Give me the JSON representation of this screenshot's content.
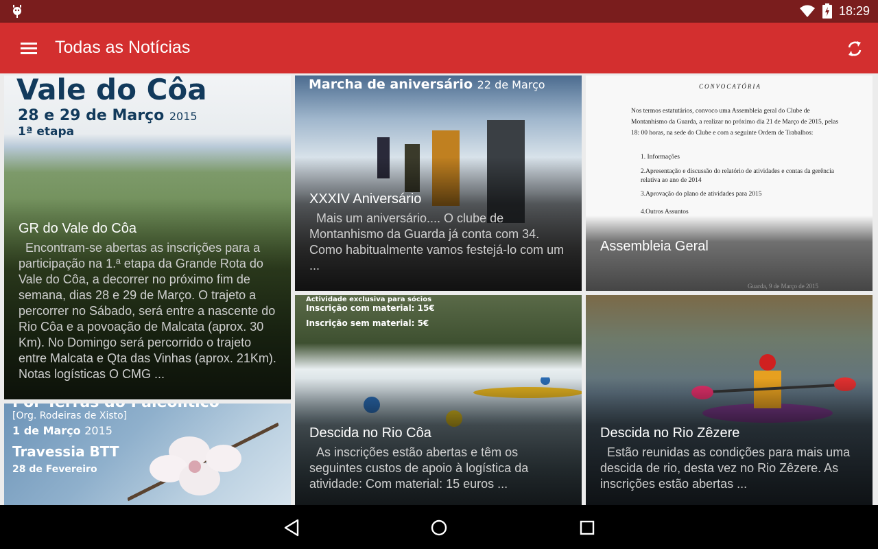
{
  "status": {
    "time": "18:29"
  },
  "appbar": {
    "title": "Todas as Notícias"
  },
  "cards": [
    {
      "title": "GR do Vale do Côa",
      "description": "Encontram-se abertas as inscrições para a participação na 1.ª etapa da Grande Rota do Vale do Côa, a decorrer no próximo fim de semana, dias 28 e 29 de Março. O trajeto a percorrer no Sábado, será entre a nascente do Rio Côa e a povoação de Malcata (aprox. 30 Km). No Domingo será percorrido o trajeto entre Malcata e Qta das Vinhas (aprox. 21Km). Notas logísticas O CMG ...",
      "poster": {
        "line1": "Vale do Côa",
        "line2": "28 e 29 de Março",
        "year": "2015",
        "line3": "1ª etapa"
      }
    },
    {
      "title": "XXXIV Aniversário",
      "description": "Mais um aniversário.... O clube de Montanhismo da Guarda já conta com 34. Como habitualmente vamos festejá-lo com um ...",
      "poster": {
        "line1": "Marcha de aniversário",
        "date": "22 de Março"
      }
    },
    {
      "title": "Assembleia Geral",
      "document": {
        "heading": "CONVOCATÓRIA",
        "body": "Nos termos estatutários, convoco uma Assembleia geral do Clube de Montanhismo da Guarda, a realizar no próximo dia 21 de Março de 2015, pelas 18: 00 horas, na sede do Clube e com a seguinte Ordem de Trabalhos:",
        "items": [
          "1. Informações",
          "2.Apresentação e discussão do relatório de atividades e contas da gerência relativa ao ano de 2014",
          "3.Aprovação do plano de atividades para 2015",
          "4.Outros Assuntos"
        ],
        "footer": "Guarda, 9 de Março de 2015"
      }
    },
    {
      "title": "Descida no Rio Côa",
      "description": "As inscrições estão abertas e têm os seguintes custos de apoio à logística da atividade: Com material: 15 euros ...",
      "poster": {
        "l1": "Actividade exclusiva para sócios",
        "l2": "Inscrição com material: 15€",
        "l3": "Inscrição sem material: 5€"
      }
    },
    {
      "title": "Descida no Rio Zêzere",
      "description": "Estão reunidas as condições para mais uma descida de rio, desta vez no Rio Zêzere. As inscrições estão abertas ..."
    },
    {
      "poster": {
        "line1": "Por Terras do Paleolítico",
        "line2": "[Org. Rodeiras de Xisto]",
        "line3": "1 de Março",
        "year": "2015",
        "line4": "Travessia BTT",
        "line5": "28 de Fevereiro"
      }
    }
  ],
  "colors": {
    "statusbar": "#7a1d1d",
    "appbar": "#d32f2f",
    "navbar": "#000000"
  }
}
